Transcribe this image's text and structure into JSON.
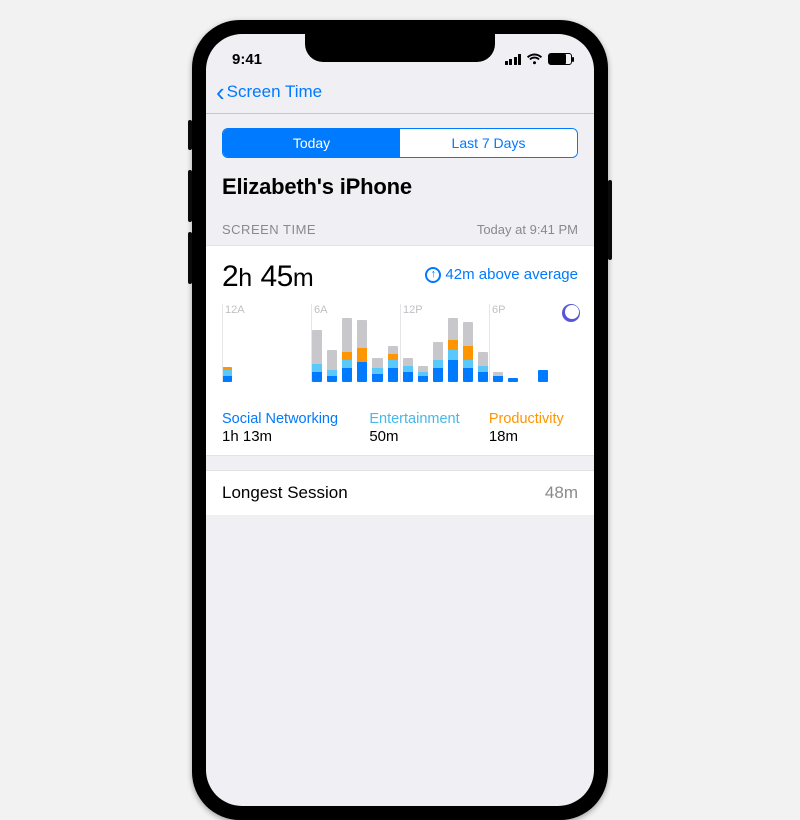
{
  "status": {
    "time": "9:41"
  },
  "nav": {
    "back_label": "Screen Time"
  },
  "tabs": {
    "today": "Today",
    "last7": "Last 7 Days"
  },
  "device_name": "Elizabeth's iPhone",
  "section": {
    "label": "SCREEN TIME",
    "timestamp": "Today at 9:41 PM"
  },
  "total": {
    "h": "2",
    "m": "45",
    "delta": "42m above average"
  },
  "legend": {
    "social": {
      "label": "Social Networking",
      "value": "1h 13m"
    },
    "ent": {
      "label": "Entertainment",
      "value": "50m"
    },
    "prod": {
      "label": "Productivity",
      "value": "18m"
    }
  },
  "longest_session": {
    "label": "Longest Session",
    "value": "48m"
  },
  "chart_data": {
    "type": "bar",
    "note": "Stacked hourly screen-time bars. Values are approximate pixel heights (relative minutes) read from the image; categories mapped to social/entertainment/productivity/other(gray). Ticks at 12A,6A,12P,6P.",
    "ticks": [
      "12A",
      "6A",
      "12P",
      "6P"
    ],
    "hours": 24,
    "series_order": [
      "social",
      "entertainment",
      "productivity",
      "other"
    ],
    "colors": {
      "social": "#007aff",
      "entertainment": "#5ac8fa",
      "productivity": "#ff9500",
      "other": "#c7c7cc"
    },
    "bars": [
      {
        "social": 6,
        "entertainment": 6,
        "productivity": 3,
        "other": 0
      },
      {
        "social": 0,
        "entertainment": 0,
        "productivity": 0,
        "other": 0
      },
      {
        "social": 0,
        "entertainment": 0,
        "productivity": 0,
        "other": 0
      },
      {
        "social": 0,
        "entertainment": 0,
        "productivity": 0,
        "other": 0
      },
      {
        "social": 0,
        "entertainment": 0,
        "productivity": 0,
        "other": 0
      },
      {
        "social": 0,
        "entertainment": 0,
        "productivity": 0,
        "other": 0
      },
      {
        "social": 10,
        "entertainment": 8,
        "productivity": 0,
        "other": 34
      },
      {
        "social": 6,
        "entertainment": 6,
        "productivity": 0,
        "other": 20
      },
      {
        "social": 14,
        "entertainment": 8,
        "productivity": 8,
        "other": 34
      },
      {
        "social": 20,
        "entertainment": 0,
        "productivity": 14,
        "other": 28
      },
      {
        "social": 8,
        "entertainment": 6,
        "productivity": 0,
        "other": 10
      },
      {
        "social": 14,
        "entertainment": 8,
        "productivity": 6,
        "other": 8
      },
      {
        "social": 10,
        "entertainment": 6,
        "productivity": 0,
        "other": 8
      },
      {
        "social": 6,
        "entertainment": 4,
        "productivity": 0,
        "other": 6
      },
      {
        "social": 14,
        "entertainment": 8,
        "productivity": 0,
        "other": 18
      },
      {
        "social": 22,
        "entertainment": 10,
        "productivity": 10,
        "other": 22
      },
      {
        "social": 14,
        "entertainment": 8,
        "productivity": 14,
        "other": 24
      },
      {
        "social": 10,
        "entertainment": 6,
        "productivity": 0,
        "other": 14
      },
      {
        "social": 6,
        "entertainment": 0,
        "productivity": 0,
        "other": 4
      },
      {
        "social": 4,
        "entertainment": 0,
        "productivity": 0,
        "other": 0
      },
      {
        "social": 0,
        "entertainment": 0,
        "productivity": 0,
        "other": 0
      },
      {
        "social": 12,
        "entertainment": 0,
        "productivity": 0,
        "other": 0
      },
      {
        "social": 0,
        "entertainment": 0,
        "productivity": 0,
        "other": 0
      },
      {
        "social": 0,
        "entertainment": 0,
        "productivity": 0,
        "other": 0
      }
    ]
  }
}
